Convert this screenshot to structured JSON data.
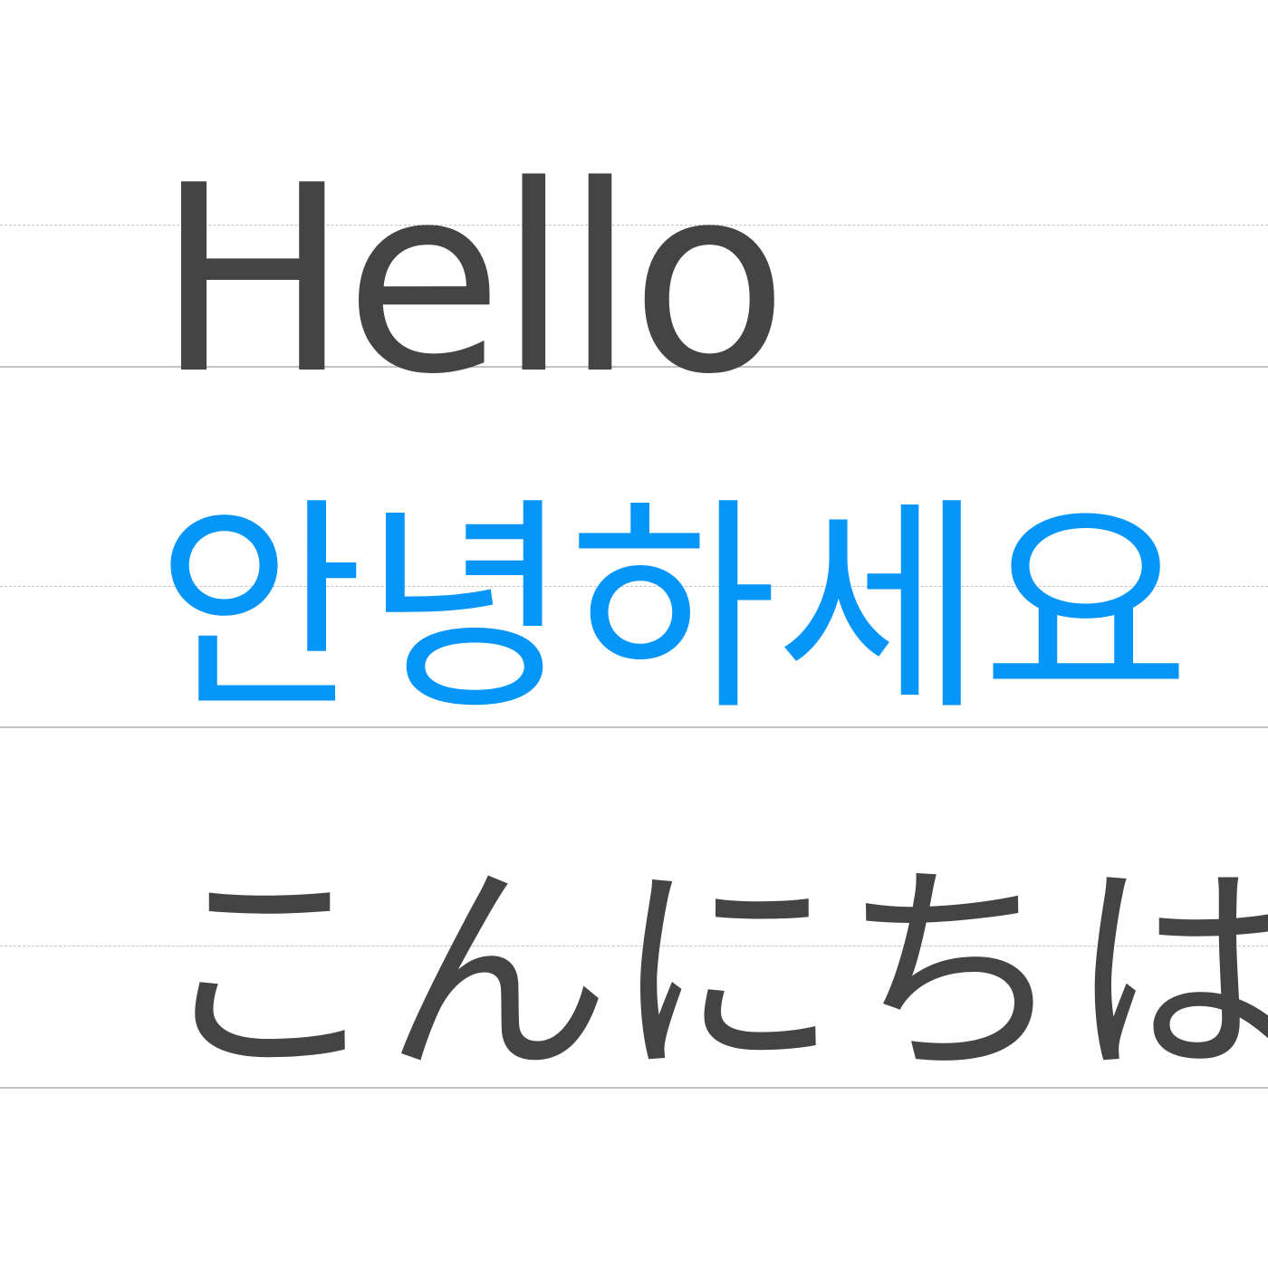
{
  "lines": [
    {
      "text": "Hello",
      "color": "#444444"
    },
    {
      "text": "안녕하세요",
      "color": "#0695f8"
    },
    {
      "text": "こんにちは",
      "color": "#444444"
    }
  ],
  "colors": {
    "baseline": "#bfc3c8",
    "midline": "#c4c4c4",
    "background": "#ffffff"
  }
}
